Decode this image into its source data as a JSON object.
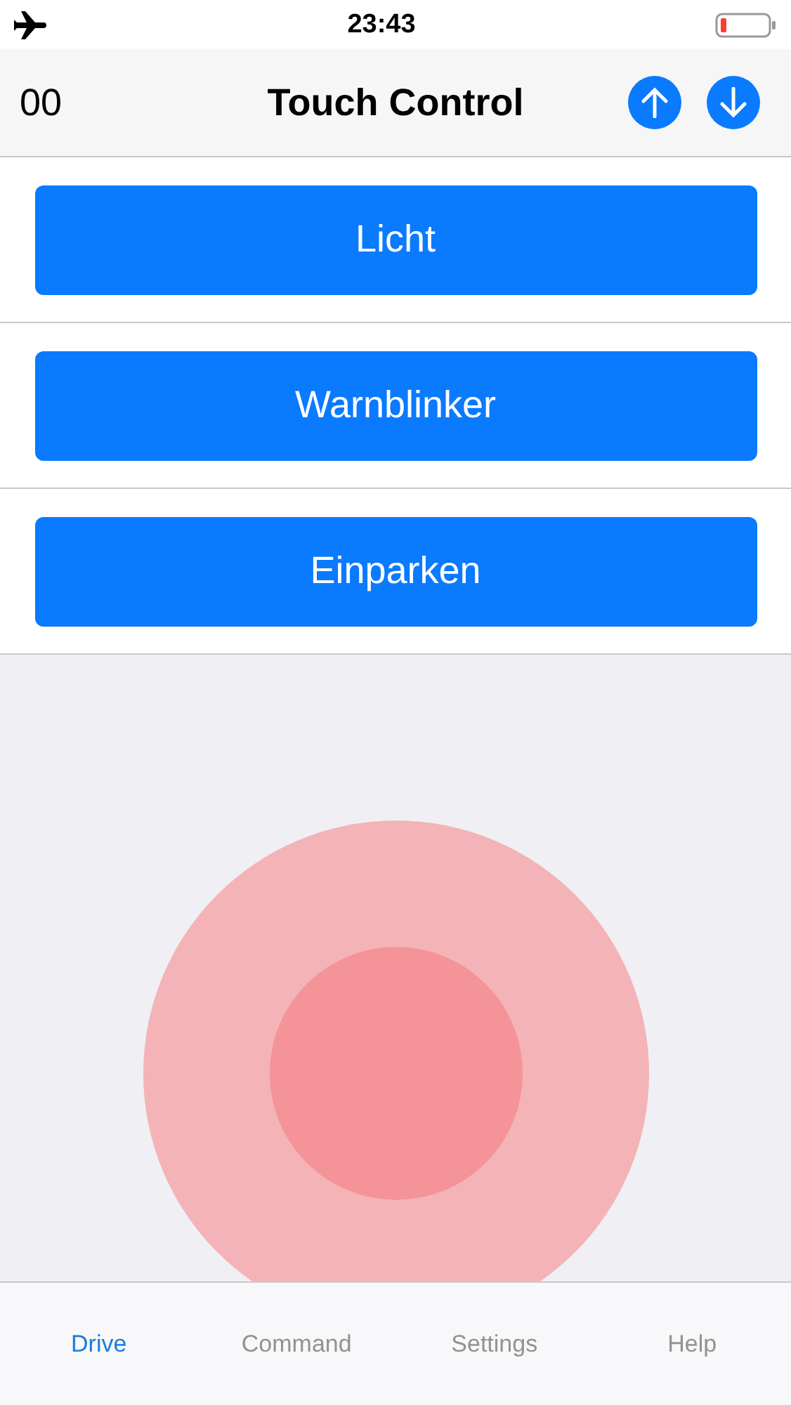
{
  "status_bar": {
    "time": "23:43"
  },
  "nav_bar": {
    "counter": "00",
    "title": "Touch Control"
  },
  "buttons": [
    {
      "label": "Licht"
    },
    {
      "label": "Warnblinker"
    },
    {
      "label": "Einparken"
    }
  ],
  "tabs": [
    {
      "label": "Drive",
      "selected": true
    },
    {
      "label": "Command",
      "selected": false
    },
    {
      "label": "Settings",
      "selected": false
    },
    {
      "label": "Help",
      "selected": false
    }
  ]
}
